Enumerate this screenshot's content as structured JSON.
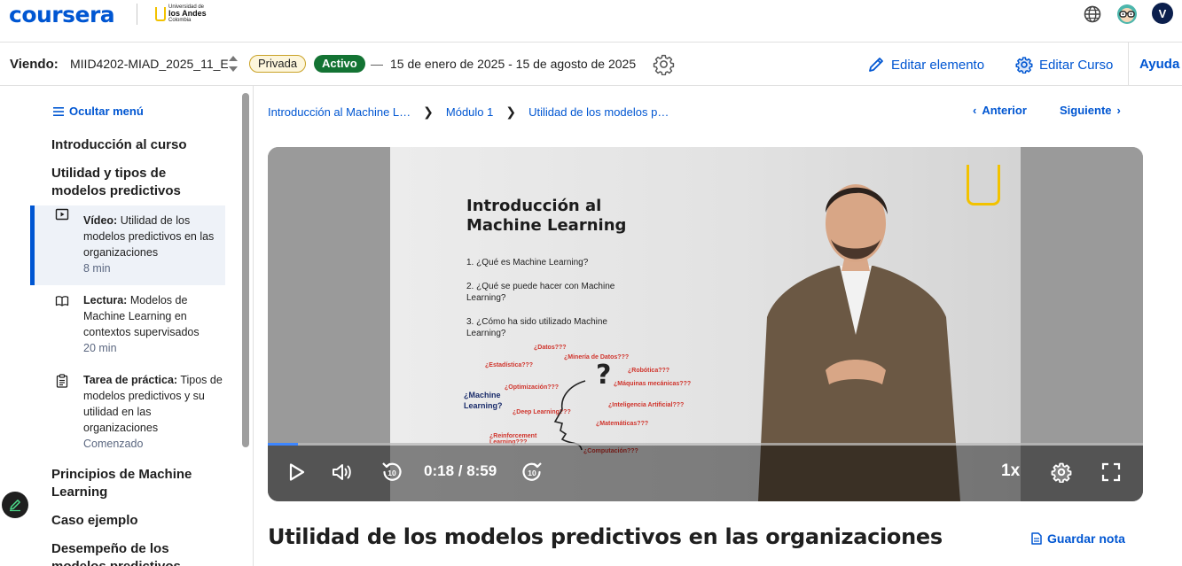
{
  "header": {
    "brand": "coursera",
    "partner_name": "Universidad de",
    "partner_bold": "los Andes",
    "partner_country": "Colombia",
    "avatar_initial": "V",
    "icons": [
      "globe-icon",
      "eyeglasses-avatar-icon"
    ]
  },
  "course_bar": {
    "viewing_label": "Viendo:",
    "course_code": "MIID4202-MIAD_2025_11_E",
    "privacy_badge": "Privada",
    "status_badge": "Activo",
    "dash": "—",
    "date_range": "15 de enero de 2025 - 15 de agosto de 2025",
    "edit_item": "Editar elemento",
    "edit_course": "Editar Curso",
    "help": "Ayuda"
  },
  "sidebar": {
    "hide_menu": "Ocultar menú",
    "headings": [
      "Introducción al curso",
      "Utilidad y tipos de modelos predictivos",
      "Principios de Machine Learning",
      "Caso ejemplo",
      "Desempeño de los modelos predictivos"
    ],
    "items": [
      {
        "kind": "Vídeo:",
        "title": "Utilidad de los modelos predictivos en las organizaciones",
        "meta": "8 min",
        "icon": "play-icon",
        "active": true
      },
      {
        "kind": "Lectura:",
        "title": "Modelos de Machine Learning en contextos supervisados",
        "meta": "20 min",
        "icon": "book-icon",
        "active": false
      },
      {
        "kind": "Tarea de práctica:",
        "title": "Tipos de modelos predictivos y su utilidad en las organizaciones",
        "meta": "Comenzado",
        "icon": "clipboard-icon",
        "active": false
      }
    ]
  },
  "breadcrumbs": [
    "Introducción al Machine L…",
    "Módulo 1",
    "Utilidad de los modelos p…"
  ],
  "nav": {
    "previous": "Anterior",
    "next": "Siguiente"
  },
  "video": {
    "slide_title_line1": "Introducción al",
    "slide_title_line2": "Machine Learning",
    "slide_points": [
      "1.  ¿Qué es Machine Learning?",
      "2.  ¿Qué se puede hacer con Machine Learning?",
      "3.  ¿Cómo ha sido utilizado Machine Learning?"
    ],
    "slide_center_line1": "¿Machine",
    "slide_center_line2": "Learning?",
    "slide_question_mark": "?",
    "slide_words": [
      "¿Datos???",
      "¿Minería de Datos???",
      "¿Estadística???",
      "¿Robótica???",
      "¿Optimización???",
      "¿Máquinas mecánicas???",
      "¿Deep Learning???",
      "¿Inteligencia Artificial???",
      "¿Matemáticas???",
      "¿Reinforcement Learning???",
      "¿Computación???"
    ],
    "current_time": "0:18",
    "duration": "8:59",
    "time_display": "0:18 / 8:59",
    "progress": 0.034,
    "speed": "1x"
  },
  "lesson": {
    "title": "Utilidad de los modelos predictivos en las organizaciones",
    "save_note": "Guardar nota"
  },
  "colors": {
    "brand_blue": "#0056d2",
    "active_green": "#137333",
    "private_bg": "#fdf6dc",
    "uniandes_yellow": "#f2c200"
  }
}
